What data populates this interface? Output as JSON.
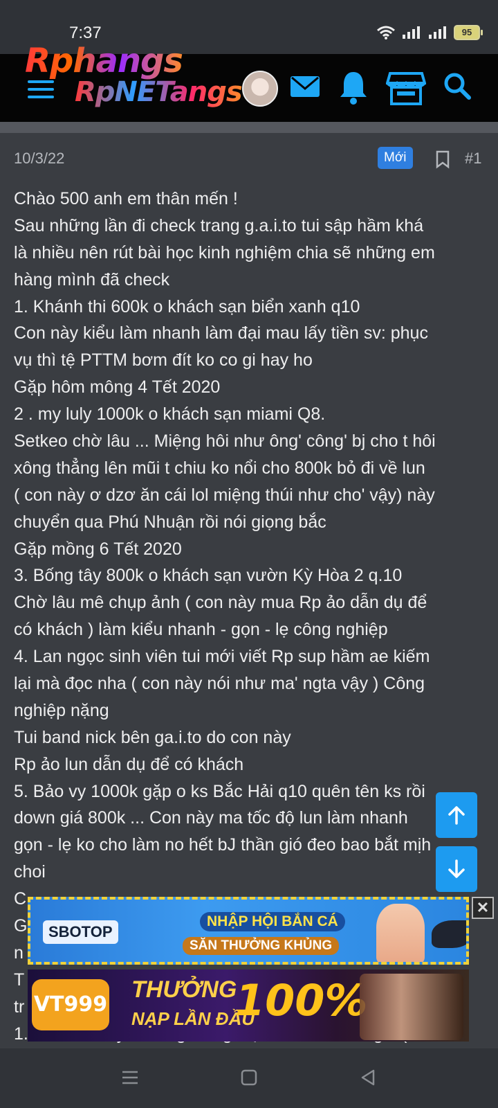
{
  "status_bar": {
    "time": "7:37",
    "battery": "95"
  },
  "app_bar": {
    "logo_line1": "Rphangs",
    "logo_line2": "RpNETangs"
  },
  "post": {
    "date": "10/3/22",
    "badge": "Mới",
    "number": "#1",
    "lines": [
      "Chào 500 anh em thân mến !",
      "Sau những lần đi check trang g.a.i.to tui sập hầm khá",
      "là nhiều nên rút bài học kinh nghiệm chia sẽ những em",
      "hàng mình đã check",
      "1. Khánh thi 600k o khách sạn biển xanh q10",
      "Con này kiểu làm nhanh làm đại mau lấy tiền sv: phục",
      "vụ thì tệ PTTM bơm đít ko co gi hay ho",
      "Gặp hôm mông 4 Tết 2020",
      "2 . my luly 1000k o khách sạn miami Q8.",
      "Setkeo chờ lâu ... Miệng hôi như ông' công' bj cho t hôi",
      "xông thẳng lên mũi t chiu ko nổi cho 800k bỏ đi về lun",
      "( con này ơ dzơ ăn cái lol miệng thúi như cho' vậy) này",
      "chuyển qua Phú Nhuận rồi nói giọng bắc",
      "Gặp mồng 6 Tết 2020",
      "3. Bống tây 800k o khách sạn vườn Kỳ Hòa 2 q.10",
      "Chờ lâu mê chụp ảnh ( con này mua Rp ảo dẫn dụ để",
      "có khách ) làm kiểu nhanh - gọn - lẹ công nghiệp",
      "4. Lan ngọc sinh viên tui mới viết Rp sup hầm ae kiếm",
      "lại mà đọc nha ( con này nói như ma' ngta vậy ) Công",
      "nghiệp nặng",
      "Tui band nick bên ga.i.to do con này",
      "Rp ảo lun dẫn dụ để có khách",
      "5. Bảo vy 1000k gặp o ks Bắc Hải q10 quên tên ks rồi",
      "down giá 800k ... Con này ma tốc độ lun làm nhanh",
      "gọn - lẹ ko cho làm no hết bJ thần gió đeo bao bắt mịh",
      "choi",
      "C",
      "G",
      "n",
      "T",
      "tr",
      "1. Bến đò mấy e Hàng Đông loạt kèo nhau lên giá ( làm"
    ]
  },
  "ads": {
    "ad1": {
      "brand": "SBOTOP",
      "line1": "NHẬP HỘI BẮN CÁ",
      "line2": "SĂN THƯỞNG KHỦNG",
      "close": "✕"
    },
    "ad2": {
      "brand": "VT999",
      "line1": "THƯỞNG",
      "line2": "NẠP LẦN ĐẦU",
      "percent": "100%"
    }
  },
  "icons": {
    "menu": "hamburger-icon",
    "mail": "mail-icon",
    "bell": "bell-icon",
    "store": "store-icon",
    "search": "search-icon",
    "bookmark": "bookmark-icon",
    "up": "arrow-up-icon",
    "down": "arrow-down-icon"
  },
  "colors": {
    "accent": "#1ea7f5",
    "badge": "#2f7fe0",
    "fab": "#1d9bf0",
    "background": "#3a3d42"
  }
}
